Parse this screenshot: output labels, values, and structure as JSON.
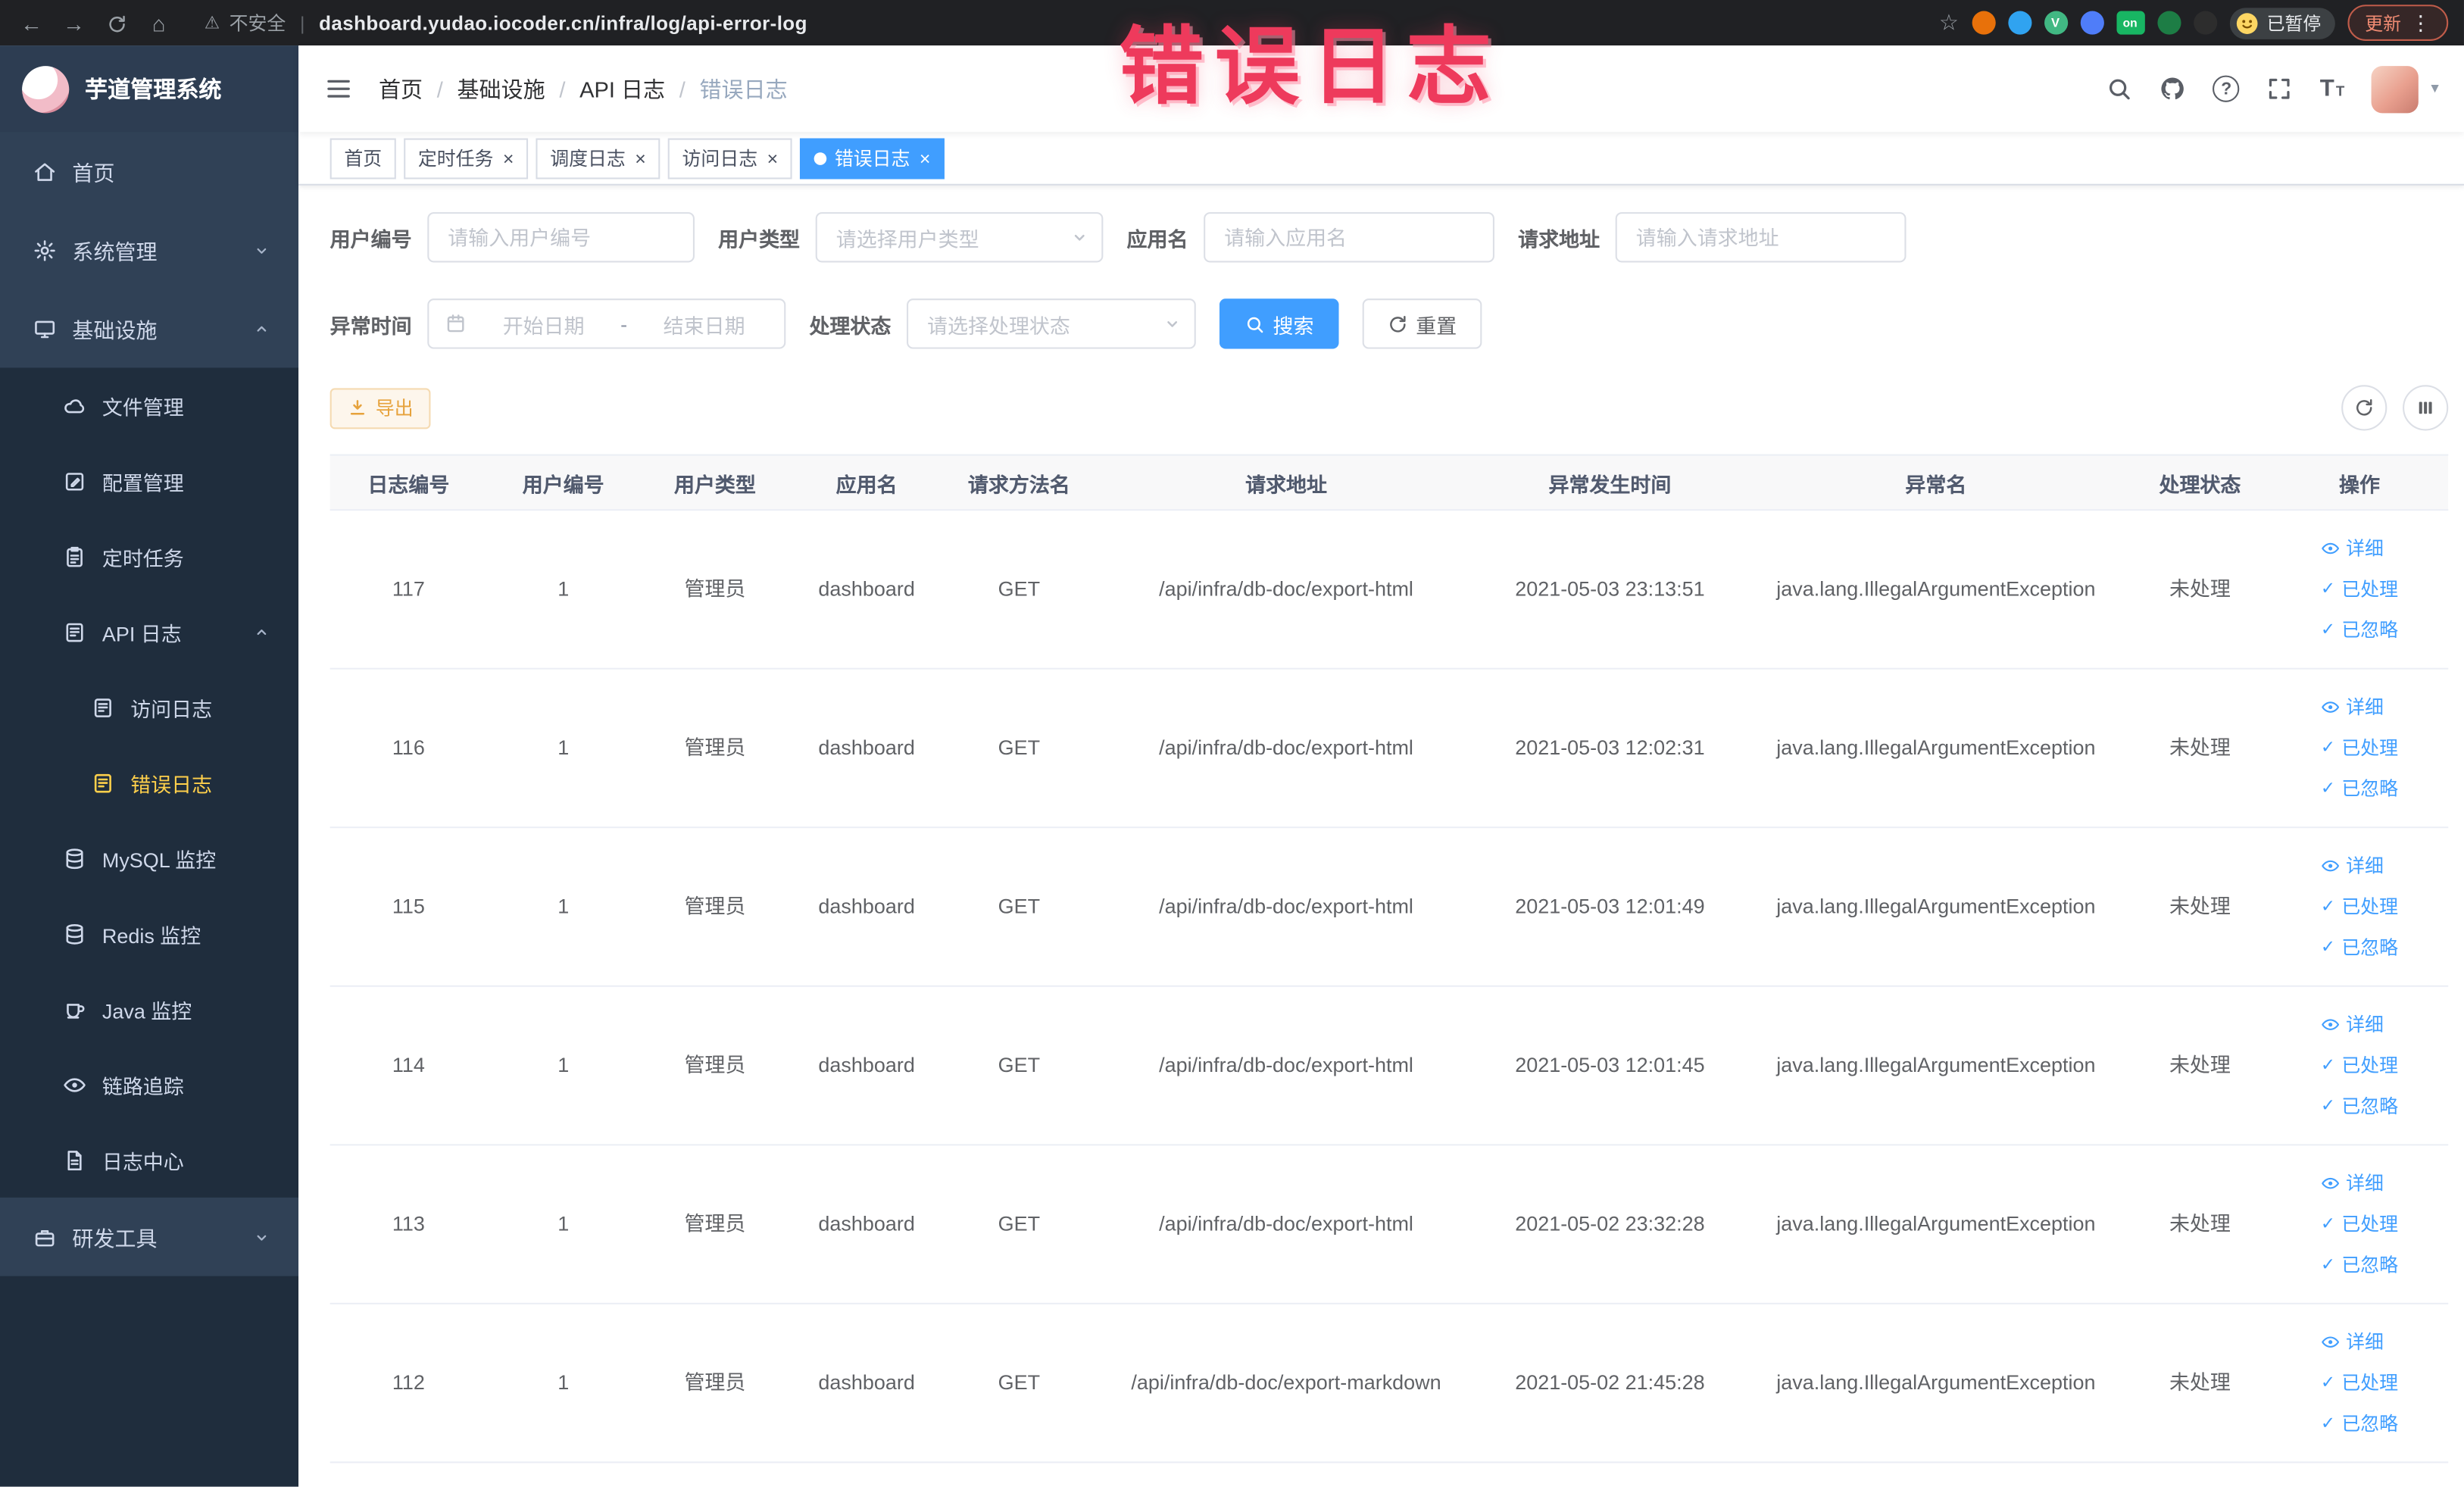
{
  "browser": {
    "security_label": "不安全",
    "url": "dashboard.yudao.iocoder.cn/infra/log/api-error-log",
    "profile_label": "已暂停",
    "update_label": "更新"
  },
  "icons": {
    "back": "←",
    "forward": "→",
    "home": "⌂",
    "warning": "⚠",
    "divider": "|",
    "star": "☆",
    "more": "⋮",
    "question": "?",
    "close": "×",
    "slash": "/",
    "check": "✓",
    "font_size": "T",
    "caret": "▾",
    "ext_v": "V",
    "ext_on": "on"
  },
  "annotation": {
    "text": "错误日志"
  },
  "sidebar": {
    "logo_title": "芋道管理系统",
    "items": [
      {
        "label": "首页"
      },
      {
        "label": "系统管理"
      },
      {
        "label": "基础设施"
      },
      {
        "label": "文件管理"
      },
      {
        "label": "配置管理"
      },
      {
        "label": "定时任务"
      },
      {
        "label": "API 日志"
      },
      {
        "label": "访问日志"
      },
      {
        "label": "错误日志"
      },
      {
        "label": "MySQL 监控"
      },
      {
        "label": "Redis 监控"
      },
      {
        "label": "Java 监控"
      },
      {
        "label": "链路追踪"
      },
      {
        "label": "日志中心"
      },
      {
        "label": "研发工具"
      }
    ]
  },
  "header": {
    "breadcrumb": [
      "首页",
      "基础设施",
      "API 日志",
      "错误日志"
    ]
  },
  "tabs": [
    {
      "label": "首页"
    },
    {
      "label": "定时任务"
    },
    {
      "label": "调度日志"
    },
    {
      "label": "访问日志"
    },
    {
      "label": "错误日志"
    }
  ],
  "filters": {
    "user_id_label": "用户编号",
    "user_id_placeholder": "请输入用户编号",
    "user_type_label": "用户类型",
    "user_type_placeholder": "请选择用户类型",
    "app_name_label": "应用名",
    "app_name_placeholder": "请输入应用名",
    "request_url_label": "请求地址",
    "request_url_placeholder": "请输入请求地址",
    "exception_time_label": "异常时间",
    "date_start_placeholder": "开始日期",
    "date_separator": "-",
    "date_end_placeholder": "结束日期",
    "status_label": "处理状态",
    "status_placeholder": "请选择处理状态",
    "search_label": "搜索",
    "reset_label": "重置"
  },
  "toolbar": {
    "export_label": "导出"
  },
  "table": {
    "headers": [
      "日志编号",
      "用户编号",
      "用户类型",
      "应用名",
      "请求方法名",
      "请求地址",
      "异常发生时间",
      "异常名",
      "处理状态",
      "操作"
    ],
    "action_detail": "详细",
    "action_processed": "已处理",
    "action_ignored": "已忽略",
    "rows": [
      {
        "id": "117",
        "user_id": "1",
        "user_type": "管理员",
        "app": "dashboard",
        "method": "GET",
        "url": "/api/infra/db-doc/export-html",
        "time": "2021-05-03 23:13:51",
        "exception": "java.lang.IllegalArgumentException",
        "status": "未处理"
      },
      {
        "id": "116",
        "user_id": "1",
        "user_type": "管理员",
        "app": "dashboard",
        "method": "GET",
        "url": "/api/infra/db-doc/export-html",
        "time": "2021-05-03 12:02:31",
        "exception": "java.lang.IllegalArgumentException",
        "status": "未处理"
      },
      {
        "id": "115",
        "user_id": "1",
        "user_type": "管理员",
        "app": "dashboard",
        "method": "GET",
        "url": "/api/infra/db-doc/export-html",
        "time": "2021-05-03 12:01:49",
        "exception": "java.lang.IllegalArgumentException",
        "status": "未处理"
      },
      {
        "id": "114",
        "user_id": "1",
        "user_type": "管理员",
        "app": "dashboard",
        "method": "GET",
        "url": "/api/infra/db-doc/export-html",
        "time": "2021-05-03 12:01:45",
        "exception": "java.lang.IllegalArgumentException",
        "status": "未处理"
      },
      {
        "id": "113",
        "user_id": "1",
        "user_type": "管理员",
        "app": "dashboard",
        "method": "GET",
        "url": "/api/infra/db-doc/export-html",
        "time": "2021-05-02 23:32:28",
        "exception": "java.lang.IllegalArgumentException",
        "status": "未处理"
      },
      {
        "id": "112",
        "user_id": "1",
        "user_type": "管理员",
        "app": "dashboard",
        "method": "GET",
        "url": "/api/infra/db-doc/export-markdown",
        "time": "2021-05-02 21:45:28",
        "exception": "java.lang.IllegalArgumentException",
        "status": "未处理"
      }
    ]
  }
}
